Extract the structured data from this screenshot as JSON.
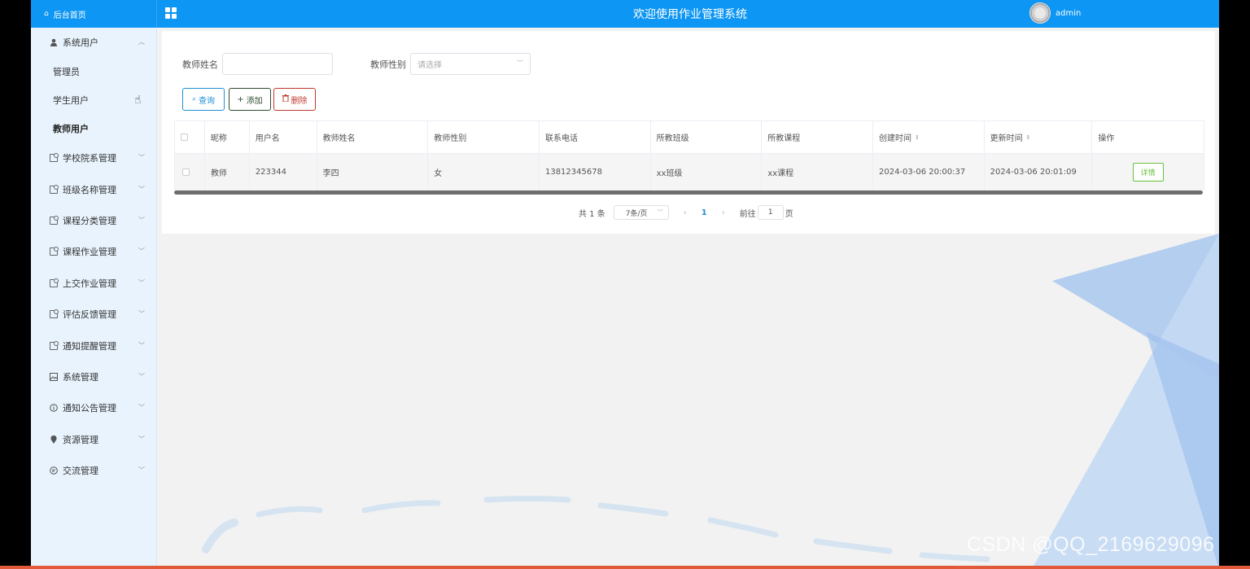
{
  "header": {
    "home_label": "后台首页",
    "title": "欢迎使用作业管理系统",
    "username": "admin"
  },
  "sidebar": {
    "open_group": {
      "label": "系统用户",
      "icon": "user-icon"
    },
    "sub_items": [
      {
        "label": "管理员"
      },
      {
        "label": "学生用户"
      },
      {
        "label": "教师用户",
        "active": true
      }
    ],
    "groups": [
      {
        "label": "学校院系管理",
        "icon": "tag-icon"
      },
      {
        "label": "班级名称管理",
        "icon": "tag-icon"
      },
      {
        "label": "课程分类管理",
        "icon": "tag-icon"
      },
      {
        "label": "课程作业管理",
        "icon": "tag-icon"
      },
      {
        "label": "上交作业管理",
        "icon": "tag-icon"
      },
      {
        "label": "评估反馈管理",
        "icon": "tag-icon"
      },
      {
        "label": "通知提醒管理",
        "icon": "tag-icon"
      },
      {
        "label": "系统管理",
        "icon": "picture-icon"
      },
      {
        "label": "通知公告管理",
        "icon": "info-icon"
      },
      {
        "label": "资源管理",
        "icon": "location-icon"
      },
      {
        "label": "交流管理",
        "icon": "chat-icon"
      }
    ]
  },
  "search": {
    "name_label": "教师姓名",
    "name_value": "",
    "gender_label": "教师性别",
    "gender_placeholder": "请选择"
  },
  "actions": {
    "query": "查询",
    "add": "添加",
    "delete": "删除"
  },
  "table": {
    "columns": [
      "昵称",
      "用户名",
      "教师姓名",
      "教师性别",
      "联系电话",
      "所教班级",
      "所教课程",
      "创建时间",
      "更新时间",
      "操作"
    ],
    "rows": [
      {
        "nickname": "教师",
        "username": "223344",
        "name": "李四",
        "gender": "女",
        "phone": "13812345678",
        "class": "xx班级",
        "course": "xx课程",
        "created": "2024-03-06 20:00:37",
        "updated": "2024-03-06 20:01:09",
        "action": "详情"
      }
    ]
  },
  "pagination": {
    "total": "共 1 条",
    "page_size": "7条/页",
    "current": "1",
    "goto_label": "前往",
    "goto_value": "1",
    "page_suffix": "页"
  },
  "watermark": "CSDN @QQ_2169629096",
  "colors": {
    "primary": "#0d96f3",
    "sidebar_bg": "#e8f3fd",
    "query_border": "#1e90d6",
    "add_border": "#2e4d2e",
    "delete_border": "#c0392b",
    "detail_green": "#67c23a"
  }
}
